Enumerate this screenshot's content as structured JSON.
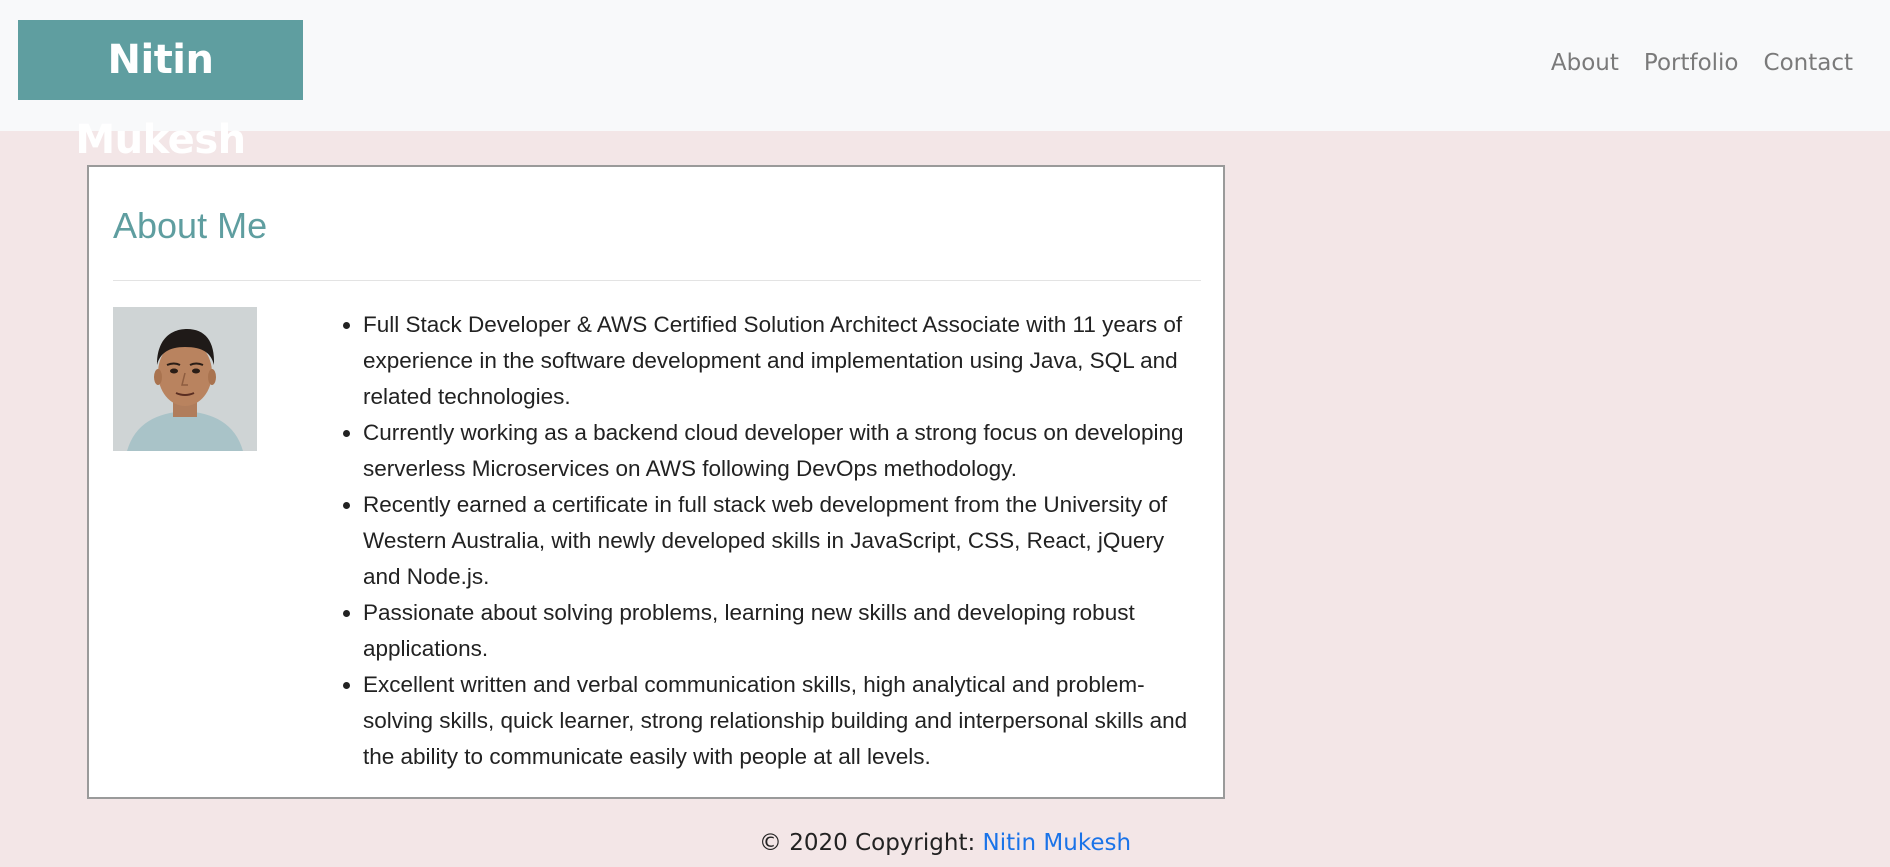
{
  "navbar": {
    "brand": "Nitin Mukesh",
    "links": [
      "About",
      "Portfolio",
      "Contact"
    ]
  },
  "about": {
    "title": "About Me",
    "photo_alt": "Profile photo",
    "bullets": [
      "Full Stack Developer & AWS Certified Solution Architect Associate with 11 years of experience in the software development and implementation using Java, SQL and related technologies.",
      "Currently working as a backend cloud developer with a strong focus on developing serverless Microservices on AWS following DevOps methodology.",
      "Recently earned a certificate in full stack web development from the University of Western Australia, with newly developed skills in JavaScript, CSS, React, jQuery and Node.js.",
      "Passionate about solving problems, learning new skills and developing robust applications.",
      "Excellent written and verbal communication skills, high analytical and problem-solving skills, quick learner, strong relationship building and interpersonal skills and the ability to communicate easily with people at all levels."
    ]
  },
  "footer": {
    "prefix": "© 2020 Copyright: ",
    "link": "Nitin Mukesh"
  },
  "colors": {
    "brand_bg": "#5f9ea0",
    "page_bg": "#f3e6e7",
    "navbar_bg": "#f8f9fa",
    "link": "#1a73e8"
  }
}
